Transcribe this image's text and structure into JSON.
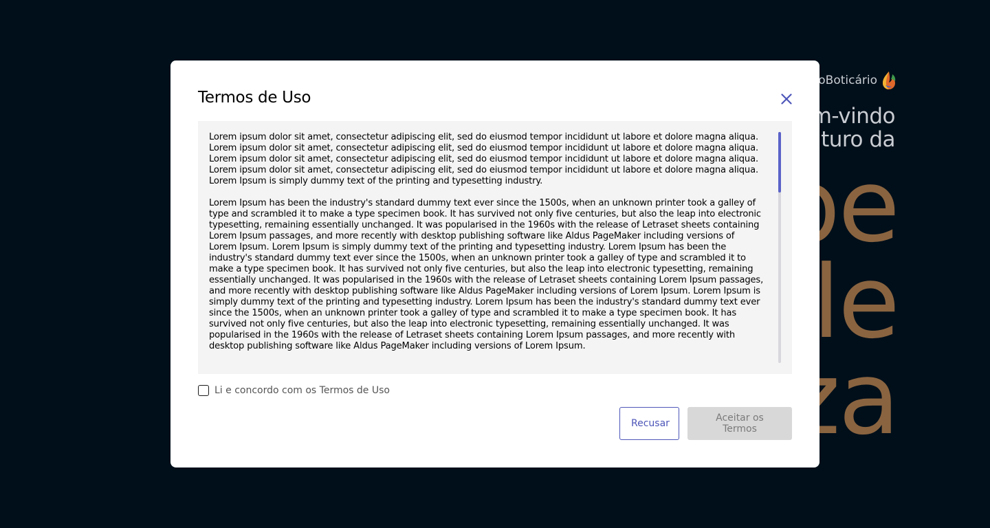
{
  "background": {
    "brand_name": "GrupoBoticário",
    "headline_lines": [
      "Bem-vindo",
      "ao futuro da"
    ],
    "big_word_lines": [
      "be",
      "le",
      "za"
    ]
  },
  "modal": {
    "title": "Termos de Uso",
    "close_icon": "close-icon",
    "terms_paragraphs": [
      "Lorem ipsum dolor sit amet, consectetur adipiscing elit, sed do eiusmod tempor incididunt ut labore et dolore magna aliqua. Lorem ipsum dolor sit amet, consectetur adipiscing elit, sed do eiusmod tempor incididunt ut labore et dolore magna aliqua. Lorem ipsum dolor sit amet, consectetur adipiscing elit, sed do eiusmod tempor incididunt ut labore et dolore magna aliqua. Lorem ipsum dolor sit amet, consectetur adipiscing elit, sed do eiusmod tempor incididunt ut labore et dolore magna aliqua. Lorem Ipsum is simply dummy text of the printing and typesetting industry.",
      "Lorem Ipsum has been the industry's standard dummy text ever since the 1500s, when an unknown printer took a galley of type and scrambled it to make a type specimen book. It has survived not only five centuries, but also the leap into electronic typesetting, remaining essentially unchanged. It was popularised in the 1960s with the release of Letraset sheets containing Lorem Ipsum passages, and more recently with desktop publishing software like Aldus PageMaker including versions of Lorem Ipsum. Lorem Ipsum is simply dummy text of the printing and typesetting industry. Lorem Ipsum has been the industry's standard dummy text ever since the 1500s, when an unknown printer took a galley of type and scrambled it to make a type specimen book. It has survived not only five centuries, but also the leap into electronic typesetting, remaining essentially unchanged. It was popularised in the 1960s with the release of Letraset sheets containing Lorem Ipsum passages, and more recently with desktop publishing software like Aldus PageMaker including versions of Lorem Ipsum. Lorem Ipsum is simply dummy text of the printing and typesetting industry. Lorem Ipsum has been the industry's standard dummy text ever since the 1500s, when an unknown printer took a galley of type and scrambled it to make a type specimen book. It has survived not only five centuries, but also the leap into electronic typesetting, remaining essentially unchanged. It was popularised in the 1960s with the release of Letraset sheets containing Lorem Ipsum passages, and more recently with desktop publishing software like Aldus PageMaker including versions of Lorem Ipsum."
    ],
    "agree_label": "Li e concordo com os Termos de Uso",
    "agree_checked": false,
    "refuse_label": "Recusar",
    "accept_label": "Aceitar os Termos"
  },
  "colors": {
    "page_background": "#000f1a",
    "accent": "#4c55b8",
    "scroll_thumb": "#5a62c8",
    "accept_disabled_bg": "#d8d8d8",
    "terms_box_bg": "#f4f4f4",
    "background_big_text": "#8a6440"
  }
}
